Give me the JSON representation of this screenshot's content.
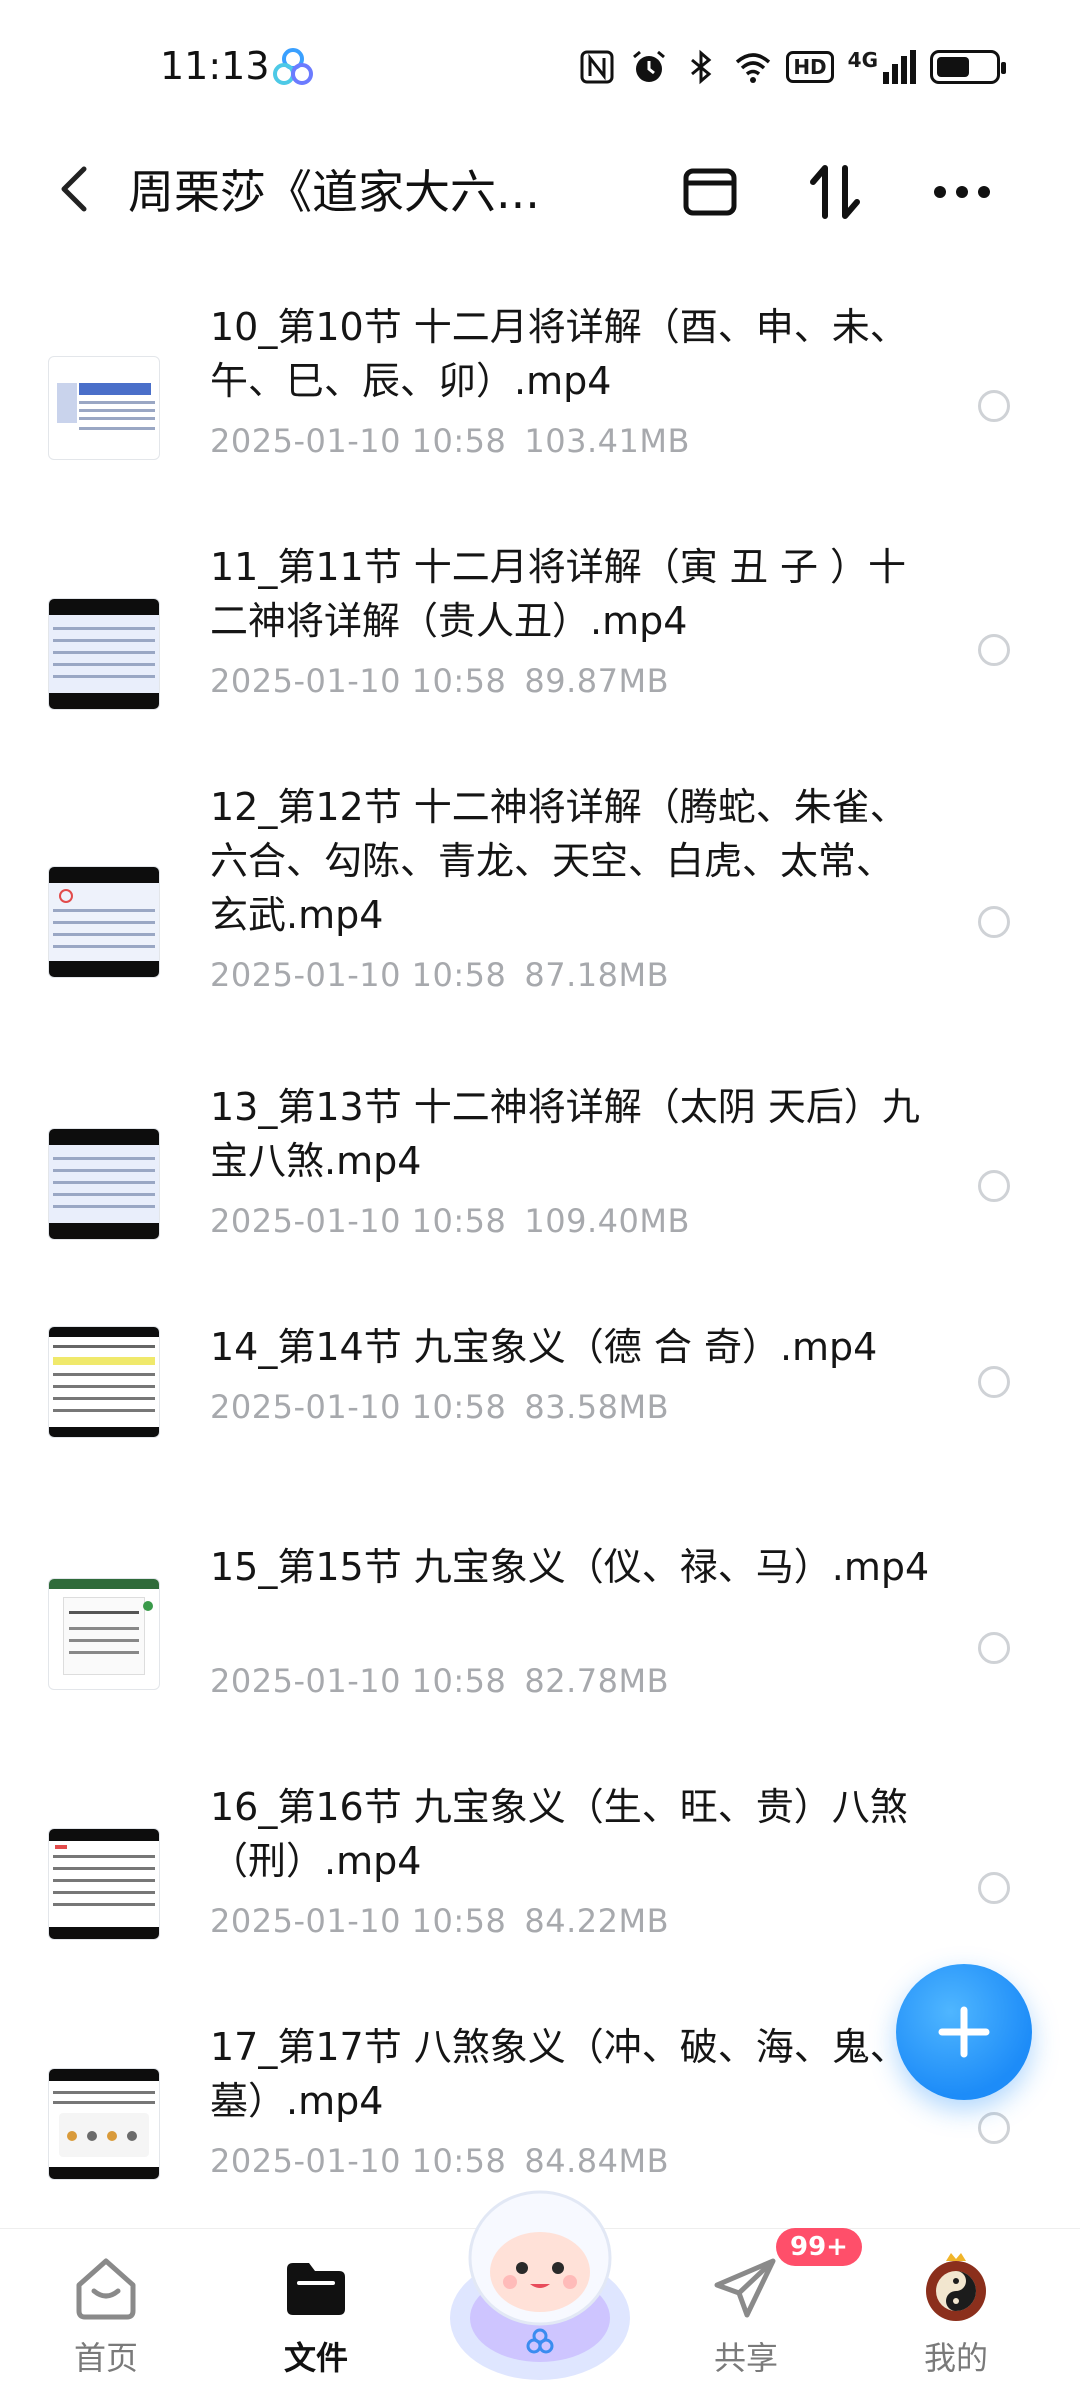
{
  "status_bar": {
    "time": "11:13",
    "icons": [
      "nfc-icon",
      "alarm-icon",
      "bluetooth-icon",
      "wifi-icon",
      "hd-icon",
      "signal-4g-icon",
      "battery-icon"
    ],
    "signal_label": "4G",
    "hd_label": "HD",
    "battery_level": 0.6
  },
  "header": {
    "title": "周栗莎《道家大六..."
  },
  "files": [
    {
      "name": "10_第10节 十二月将详解（酉、申、未、午、巳、辰、卯）.mp4",
      "date": "2025-01-10  10:58",
      "size": "103.41MB"
    },
    {
      "name": "11_第11节 十二月将详解（寅 丑 子 ）十二神将详解（贵人丑）.mp4",
      "date": "2025-01-10  10:58",
      "size": "89.87MB"
    },
    {
      "name": "12_第12节 十二神将详解（腾蛇、朱雀、六合、勾陈、青龙、天空、白虎、太常、玄武.mp4",
      "date": "2025-01-10  10:58",
      "size": "87.18MB"
    },
    {
      "name": "13_第13节 十二神将详解（太阴 天后）九宝八煞.mp4",
      "date": "2025-01-10  10:58",
      "size": "109.40MB"
    },
    {
      "name": "14_第14节 九宝象义（德 合 奇）.mp4",
      "date": "2025-01-10  10:58",
      "size": "83.58MB"
    },
    {
      "name": "15_第15节 九宝象义（仪、禄、马）.mp4",
      "date": "2025-01-10  10:58",
      "size": "82.78MB"
    },
    {
      "name": "16_第16节 九宝象义（生、旺、贵）八煞（刑）.mp4",
      "date": "2025-01-10  10:58",
      "size": "84.22MB"
    },
    {
      "name": "17_第17节 八煞象义（冲、破、海、鬼、墓）.mp4",
      "date": "2025-01-10  10:58",
      "size": "84.84MB"
    }
  ],
  "bottom_nav": {
    "items": [
      {
        "label": "首页",
        "icon": "home-icon"
      },
      {
        "label": "文件",
        "icon": "folder-icon"
      },
      {
        "label": "",
        "icon": "mascot-icon"
      },
      {
        "label": "共享",
        "icon": "share-icon"
      },
      {
        "label": "我的",
        "icon": "avatar-icon"
      }
    ],
    "share_badge": "99+"
  },
  "colors": {
    "accent": "#1d8cf8",
    "meta_text": "#a7a9ad",
    "badge": "#ff4f6a"
  }
}
